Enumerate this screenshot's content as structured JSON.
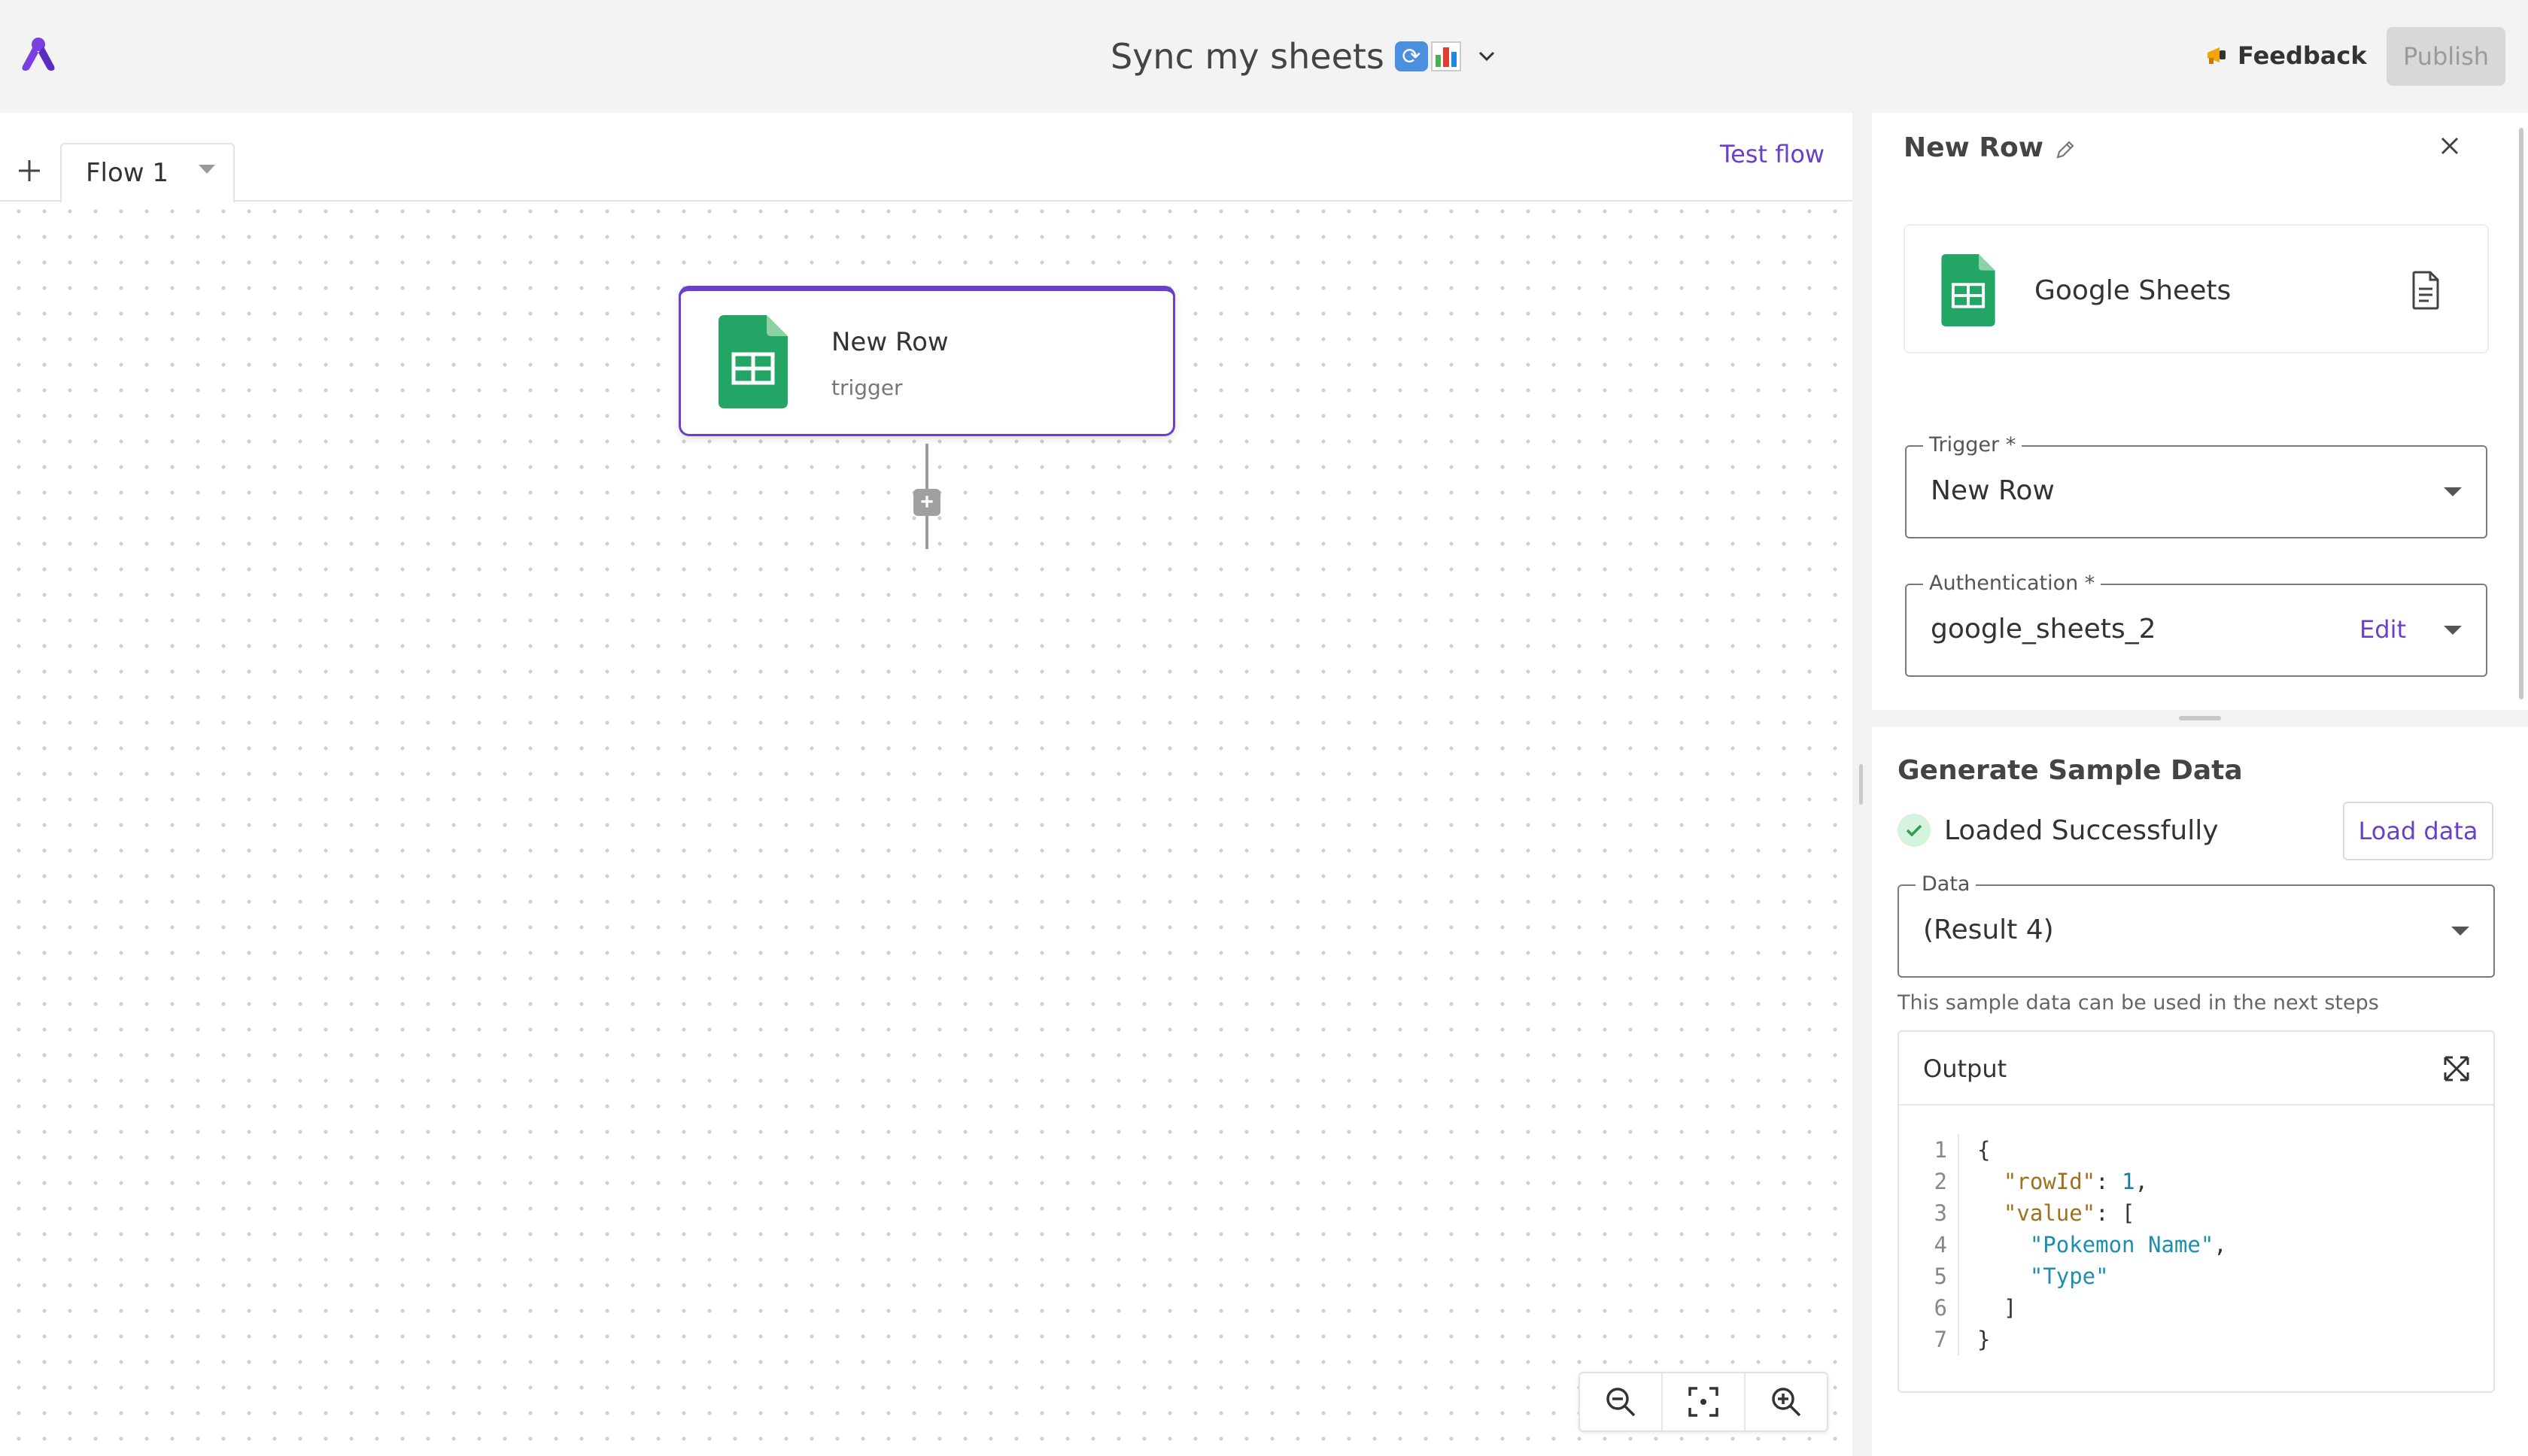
{
  "app": {
    "title": "Sync my sheets",
    "title_emoji": [
      "sync-emoji",
      "bar-chart-emoji"
    ]
  },
  "header": {
    "feedback_label": "Feedback",
    "publish_label": "Publish"
  },
  "tabs": {
    "items": [
      {
        "label": "Flow 1"
      }
    ],
    "test_flow_label": "Test flow"
  },
  "canvas": {
    "node": {
      "title": "New Row",
      "subtitle": "trigger",
      "icon": "google-sheets-icon"
    },
    "zoom_controls": [
      "zoom-out-icon",
      "fit-view-icon",
      "zoom-in-icon"
    ]
  },
  "panel": {
    "title": "New Row",
    "piece": {
      "name": "Google Sheets",
      "icon": "google-sheets-icon"
    },
    "trigger_field": {
      "label": "Trigger *",
      "value": "New Row"
    },
    "auth_field": {
      "label": "Authentication *",
      "value": "google_sheets_2",
      "edit_label": "Edit"
    },
    "sample": {
      "title": "Generate Sample Data",
      "status": "Loaded Successfully",
      "load_label": "Load data",
      "data_field": {
        "label": "Data",
        "value": "(Result 4)"
      },
      "hint": "This sample data can be used in the next steps",
      "output_title": "Output"
    }
  },
  "colors": {
    "accent": "#6a3fc9",
    "sheets_green": "#23a566",
    "success_bg": "#d6f3dd",
    "success_check": "#2e9e4f"
  }
}
